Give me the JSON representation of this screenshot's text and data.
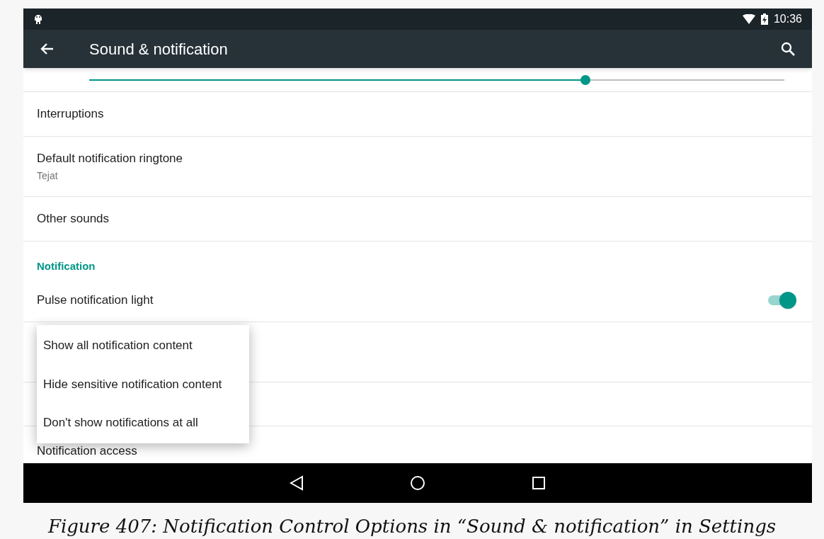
{
  "status_bar": {
    "time": "10:36"
  },
  "toolbar": {
    "title": "Sound & notification"
  },
  "volume_slider": {
    "level": 0.714
  },
  "rows": [
    {
      "kind": "item",
      "title": "Interruptions"
    },
    {
      "kind": "item",
      "title": "Default notification ringtone",
      "summary": "Tejat"
    },
    {
      "kind": "item",
      "title": "Other sounds"
    },
    {
      "kind": "header",
      "title": "Notification"
    },
    {
      "kind": "switch",
      "title": "Pulse notification light",
      "on": true
    },
    {
      "kind": "blank"
    },
    {
      "kind": "blank"
    },
    {
      "kind": "item",
      "title": "Notification access"
    }
  ],
  "popup_menu": [
    {
      "label": "Show all notification content"
    },
    {
      "label": "Hide sensitive notification content"
    },
    {
      "label": "Don't show notifications at all"
    }
  ],
  "caption": "Figure 407: Notification Control Options in “Sound & notification” in Settings"
}
